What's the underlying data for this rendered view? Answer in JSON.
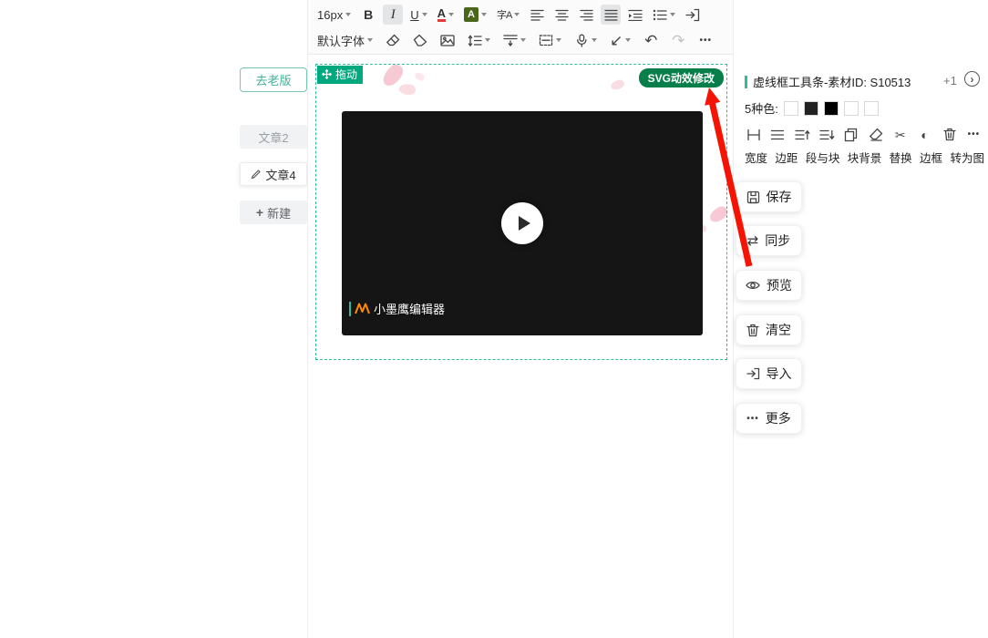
{
  "accent": {
    "teal": "#2dbd9e",
    "drag_green": "#00a87e",
    "badge_green": "#087f4b",
    "arrow_red": "#f51303"
  },
  "toolbar": {
    "font_size": "16px",
    "font_family": "默认字体",
    "bold": "B",
    "italic": "I",
    "underline": "U",
    "font_color": "A",
    "bg_color": "A",
    "text_style": "字A"
  },
  "icons": {
    "undo": "↶",
    "redo": "↷",
    "dots": "•••",
    "arrow_sw": "↙",
    "scissors": "✂",
    "contrast": "◐",
    "sync": "⇄",
    "chevron_right": "›",
    "plus": "+"
  },
  "sidebar": {
    "old_version_label": "去老版",
    "items": [
      {
        "label": "文章2"
      },
      {
        "label": "文章4"
      },
      {
        "label": "新建"
      }
    ]
  },
  "canvas": {
    "drag_label": "拖动",
    "svg_badge_label": "SVG动效修改",
    "video_watermark": "小墨鹰编辑器"
  },
  "panel": {
    "header_title": "虚线框工具条-素材ID: S10513",
    "counter": "+1",
    "colors_label": "5种色:",
    "swatches": [
      "#ffffff",
      "#222222",
      "#000000",
      "#ffffff",
      "#ffffff"
    ],
    "tool_labels": [
      "宽度",
      "边距",
      "段与块",
      "块背景",
      "替换",
      "边框",
      "转为图"
    ],
    "buttons": [
      {
        "label": "保存"
      },
      {
        "label": "同步"
      },
      {
        "label": "预览"
      },
      {
        "label": "清空"
      },
      {
        "label": "导入"
      },
      {
        "label": "更多"
      }
    ]
  }
}
